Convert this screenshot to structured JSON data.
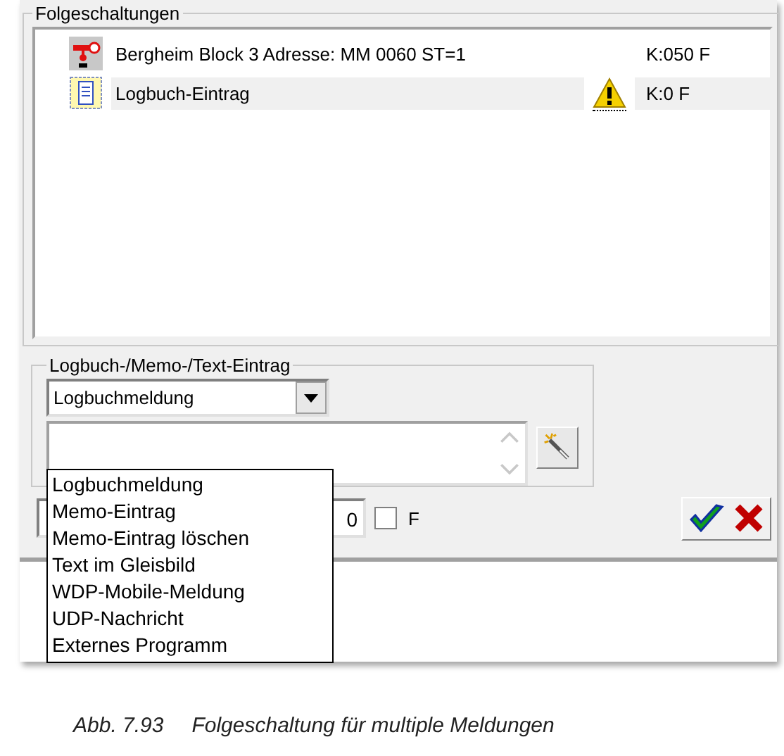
{
  "group": {
    "title": "Folgeschaltungen",
    "items": [
      {
        "kind": "signal",
        "label": "Bergheim Block 3 Adresse: MM 0060 ST=1",
        "warning": false,
        "code": "K:050 F",
        "selected": false
      },
      {
        "kind": "logbook",
        "label": "Logbuch-Eintrag",
        "warning": true,
        "code": "K:0 F",
        "selected": true
      }
    ]
  },
  "entry": {
    "title": "Logbuch-/Memo-/Text-Eintrag",
    "combo_value": "Logbuchmeldung",
    "options": [
      {
        "label": "Logbuchmeldung",
        "selected": false
      },
      {
        "label": "Memo-Eintrag",
        "selected": false
      },
      {
        "label": "Memo-Eintrag löschen",
        "selected": false
      },
      {
        "label": "Text im Gleisbild",
        "selected": false
      },
      {
        "label": "WDP-Mobile-Meldung",
        "selected": false
      },
      {
        "label": "UDP-Nachricht",
        "selected": false
      },
      {
        "label": "Externes Programm",
        "selected": false
      }
    ]
  },
  "bottom": {
    "field_value": "0",
    "checkbox": {
      "label": "F",
      "checked": false
    }
  },
  "caption": {
    "number": "Abb. 7.93",
    "text": "Folgeschaltung für multiple Meldungen"
  }
}
